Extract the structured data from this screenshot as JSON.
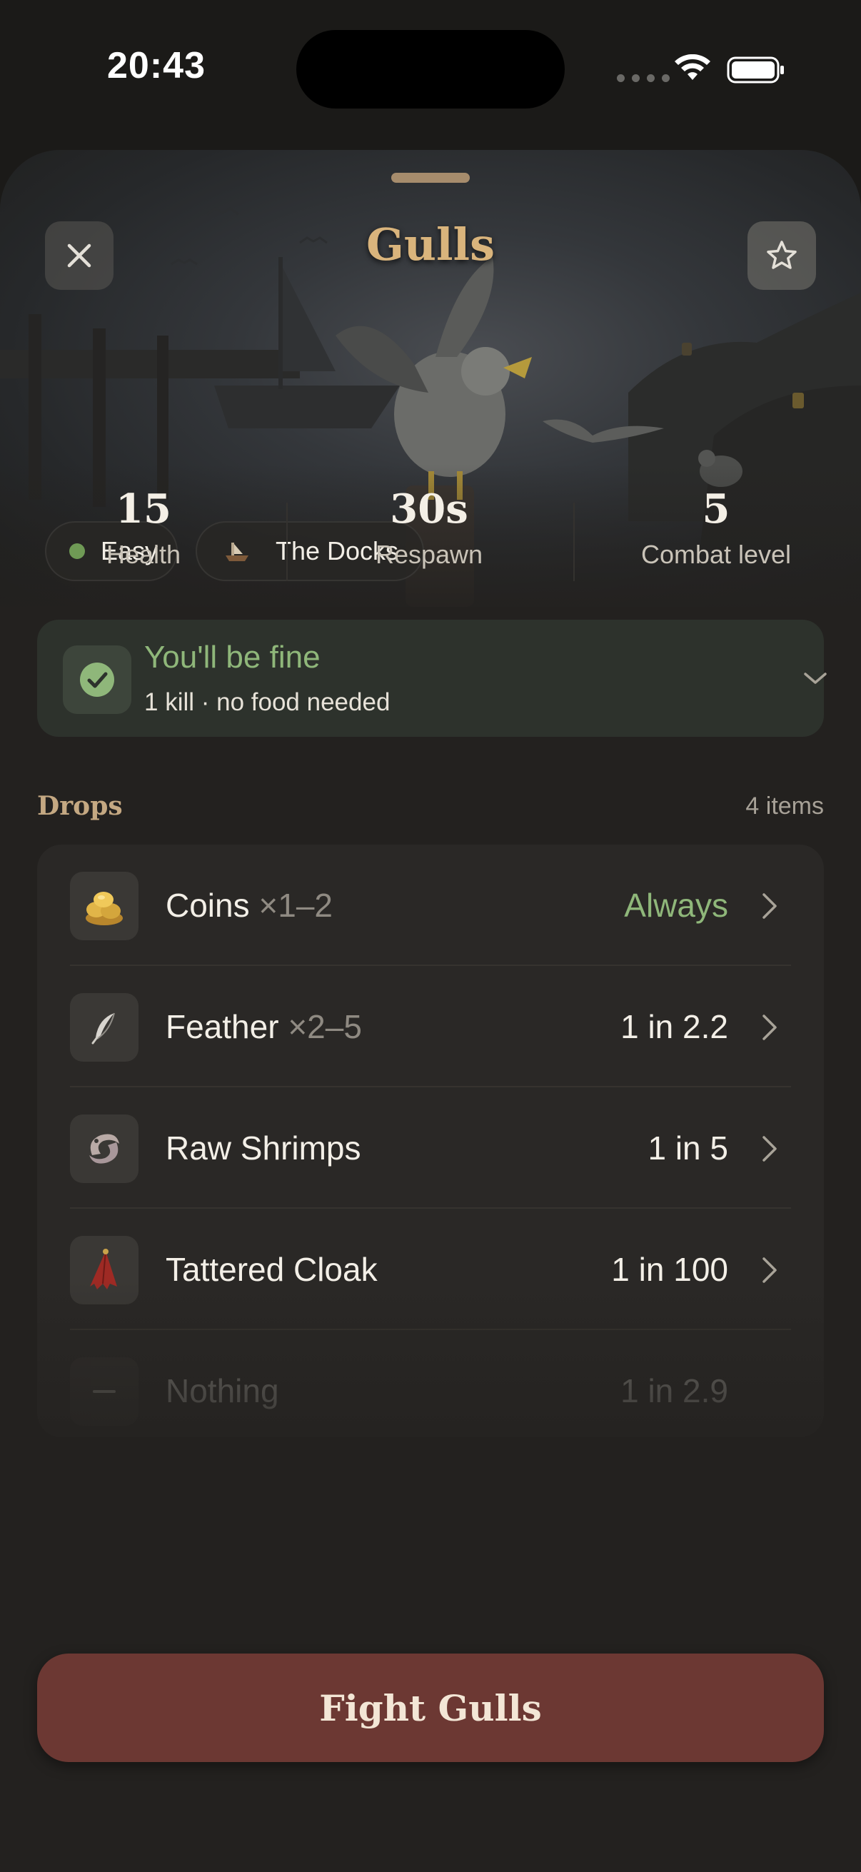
{
  "status_bar": {
    "time": "20:43"
  },
  "header": {
    "title": "Gulls"
  },
  "tags": {
    "difficulty": "Easy",
    "location": "The Docks"
  },
  "stats": [
    {
      "value": "15",
      "label": "Health"
    },
    {
      "value": "30s",
      "label": "Respawn"
    },
    {
      "value": "5",
      "label": "Combat level"
    }
  ],
  "safety": {
    "title": "You'll be fine",
    "subtitle": "1 kill · no food needed"
  },
  "drops": {
    "title": "Drops",
    "count": "4 items",
    "items": [
      {
        "name": "Coins",
        "qty": "×1–2",
        "rate": "Always",
        "icon": "coins-icon"
      },
      {
        "name": "Feather",
        "qty": "×2–5",
        "rate": "1 in 2.2",
        "icon": "feather-icon"
      },
      {
        "name": "Raw Shrimps",
        "qty": "",
        "rate": "1 in 5",
        "icon": "shrimp-icon"
      },
      {
        "name": "Tattered Cloak",
        "qty": "",
        "rate": "1 in 100",
        "icon": "cloak-icon"
      },
      {
        "name": "Nothing",
        "qty": "",
        "rate": "1 in 2.9",
        "icon": "dash-icon"
      }
    ]
  },
  "action": {
    "fight_label": "Fight Gulls"
  },
  "colors": {
    "accent_gold": "#d9b47c",
    "safe_green": "#8fb77a",
    "fight_red": "#6c3833"
  }
}
